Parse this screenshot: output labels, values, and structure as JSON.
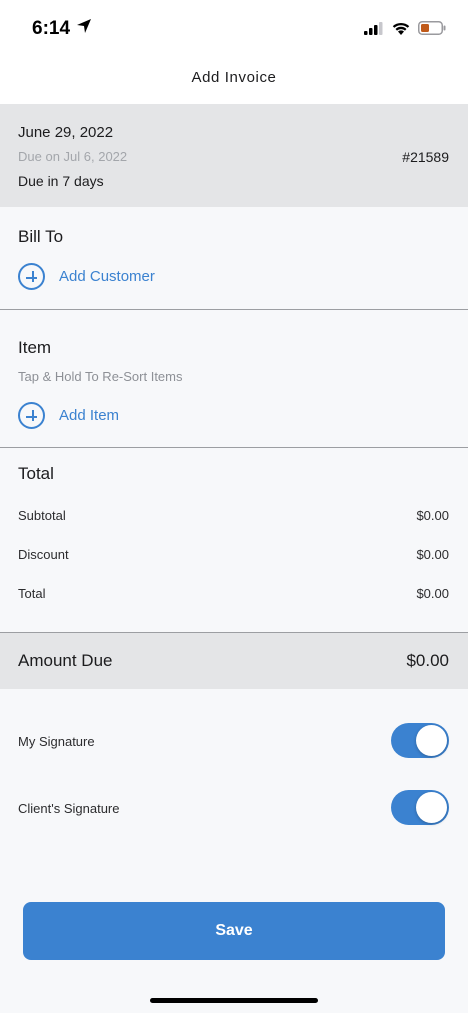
{
  "status_bar": {
    "time": "6:14",
    "icons": [
      "location-arrow-icon",
      "cellular-signal-icon",
      "wifi-icon",
      "battery-low-icon"
    ],
    "battery_color": "#c05a1a"
  },
  "nav": {
    "title": "Add Invoice"
  },
  "invoice_header": {
    "date": "June 29, 2022",
    "due_on": "Due on Jul 6, 2022",
    "due_in": "Due in 7 days",
    "number": "#21589"
  },
  "bill_to": {
    "title": "Bill To",
    "add_label": "Add Customer",
    "icon": "plus-circle-icon"
  },
  "items": {
    "title": "Item",
    "hint": "Tap & Hold To Re-Sort Items",
    "add_label": "Add Item",
    "icon": "plus-circle-icon"
  },
  "totals": {
    "title": "Total",
    "rows": [
      {
        "label": "Subtotal",
        "value": "$0.00"
      },
      {
        "label": "Discount",
        "value": "$0.00"
      },
      {
        "label": "Total",
        "value": "$0.00"
      }
    ]
  },
  "amount_due": {
    "label": "Amount Due",
    "value": "$0.00"
  },
  "signatures": [
    {
      "label": "My Signature",
      "enabled": true
    },
    {
      "label": "Client's Signature",
      "enabled": true
    }
  ],
  "save_label": "Save",
  "colors": {
    "accent": "#3b82d0",
    "header_bg": "#e4e5e7",
    "page_bg": "#f7f8fa"
  }
}
